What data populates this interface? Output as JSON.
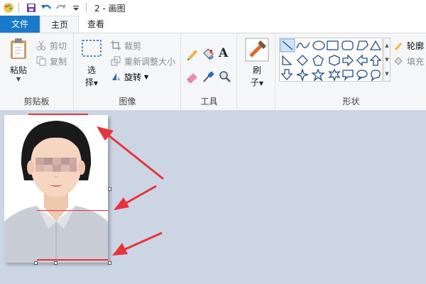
{
  "titlebar": {
    "title": "2 - 画图"
  },
  "tabs": {
    "file": "文件",
    "home": "主页",
    "view": "查看"
  },
  "clipboard": {
    "paste": "粘贴",
    "cut": "剪切",
    "copy": "复制",
    "label": "剪贴板"
  },
  "image": {
    "select_line1": "选",
    "select_line2": "择",
    "crop": "裁剪",
    "resize": "重新调整大小",
    "rotate": "旋转",
    "label": "图像"
  },
  "tools": {
    "label": "工具"
  },
  "brushes": {
    "line1": "刷",
    "line2": "子"
  },
  "shapes": {
    "label": "形状",
    "outline": "轮廓",
    "fill": "填充"
  },
  "colors": {
    "accent": "#1979ca",
    "arrow": "#e8333a"
  }
}
